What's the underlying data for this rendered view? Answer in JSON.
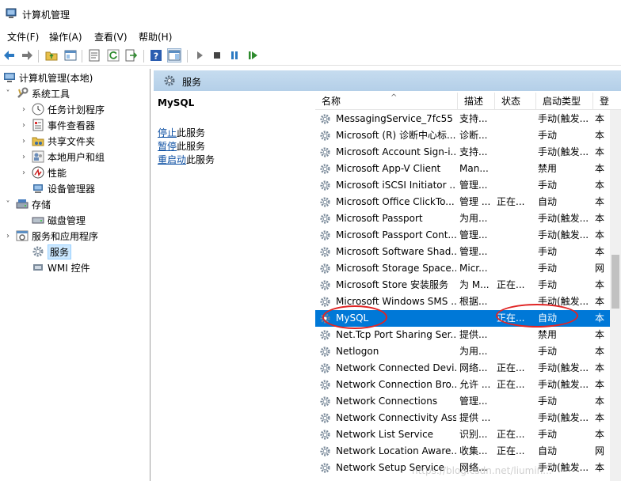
{
  "window": {
    "title": "计算机管理"
  },
  "menu": [
    "文件(F)",
    "操作(A)",
    "查看(V)",
    "帮助(H)"
  ],
  "toolbar": {
    "buttons": [
      "back-icon",
      "forward-icon",
      "up-folder-icon",
      "show-hide-tree-icon",
      "properties-icon",
      "refresh-icon",
      "export-icon",
      "help-icon",
      "show-action-pane-icon",
      "start-service-icon",
      "stop-service-icon",
      "pause-service-icon",
      "resume-service-icon"
    ]
  },
  "tree": {
    "root": "计算机管理(本地)",
    "system_tools": "系统工具",
    "task_scheduler": "任务计划程序",
    "event_viewer": "事件查看器",
    "shared_folders": "共享文件夹",
    "local_users": "本地用户和组",
    "performance": "性能",
    "device_manager": "设备管理器",
    "storage": "存储",
    "disk_management": "磁盘管理",
    "services_apps": "服务和应用程序",
    "services": "服务",
    "wmi": "WMI 控件"
  },
  "pane": {
    "header": "服务",
    "selected_service": "MySQL",
    "stop_link": "停止",
    "stop_suffix": "此服务",
    "pause_link": "暂停",
    "pause_suffix": "此服务",
    "restart_link": "重启动",
    "restart_suffix": "此服务"
  },
  "columns": {
    "name": "名称",
    "desc": "描述",
    "status": "状态",
    "startup": "启动类型",
    "logon": "登"
  },
  "rows": [
    {
      "name": "MessagingService_7fc55",
      "desc": "支持...",
      "status": "",
      "startup": "手动(触发...",
      "logon": "本"
    },
    {
      "name": "Microsoft (R) 诊断中心标...",
      "desc": "诊断...",
      "status": "",
      "startup": "手动",
      "logon": "本"
    },
    {
      "name": "Microsoft Account Sign-i...",
      "desc": "支持...",
      "status": "",
      "startup": "手动(触发...",
      "logon": "本"
    },
    {
      "name": "Microsoft App-V Client",
      "desc": "Man...",
      "status": "",
      "startup": "禁用",
      "logon": "本"
    },
    {
      "name": "Microsoft iSCSI Initiator ...",
      "desc": "管理...",
      "status": "",
      "startup": "手动",
      "logon": "本"
    },
    {
      "name": "Microsoft Office ClickTo...",
      "desc": "管理 ...",
      "status": "正在...",
      "startup": "自动",
      "logon": "本"
    },
    {
      "name": "Microsoft Passport",
      "desc": "为用...",
      "status": "",
      "startup": "手动(触发...",
      "logon": "本"
    },
    {
      "name": "Microsoft Passport Cont...",
      "desc": "管理...",
      "status": "",
      "startup": "手动(触发...",
      "logon": "本"
    },
    {
      "name": "Microsoft Software Shad...",
      "desc": "管理...",
      "status": "",
      "startup": "手动",
      "logon": "本"
    },
    {
      "name": "Microsoft Storage Space...",
      "desc": "Micr...",
      "status": "",
      "startup": "手动",
      "logon": "网"
    },
    {
      "name": "Microsoft Store 安装服务",
      "desc": "为 M...",
      "status": "正在...",
      "startup": "手动",
      "logon": "本"
    },
    {
      "name": "Microsoft Windows SMS ...",
      "desc": "根据...",
      "status": "",
      "startup": "手动(触发...",
      "logon": "本"
    },
    {
      "name": "MySQL",
      "desc": "",
      "status": "正在...",
      "startup": "自动",
      "logon": "本"
    },
    {
      "name": "Net.Tcp Port Sharing Ser...",
      "desc": "提供...",
      "status": "",
      "startup": "禁用",
      "logon": "本"
    },
    {
      "name": "Netlogon",
      "desc": "为用...",
      "status": "",
      "startup": "手动",
      "logon": "本"
    },
    {
      "name": "Network Connected Devi...",
      "desc": "网络...",
      "status": "正在...",
      "startup": "手动(触发...",
      "logon": "本"
    },
    {
      "name": "Network Connection Bro...",
      "desc": "允许 ...",
      "status": "正在...",
      "startup": "手动(触发...",
      "logon": "本"
    },
    {
      "name": "Network Connections",
      "desc": "管理...",
      "status": "",
      "startup": "手动",
      "logon": "本"
    },
    {
      "name": "Network Connectivity Ass...",
      "desc": "提供 ...",
      "status": "",
      "startup": "手动(触发...",
      "logon": "本"
    },
    {
      "name": "Network List Service",
      "desc": "识别...",
      "status": "正在...",
      "startup": "手动",
      "logon": "本"
    },
    {
      "name": "Network Location Aware...",
      "desc": "收集...",
      "status": "正在...",
      "startup": "自动",
      "logon": "网"
    },
    {
      "name": "Network Setup Service",
      "desc": "网络...",
      "status": "",
      "startup": "手动(触发...",
      "logon": "本"
    }
  ],
  "selected_row_index": 12,
  "watermark": "https://blog.csdn.net/liumin..."
}
